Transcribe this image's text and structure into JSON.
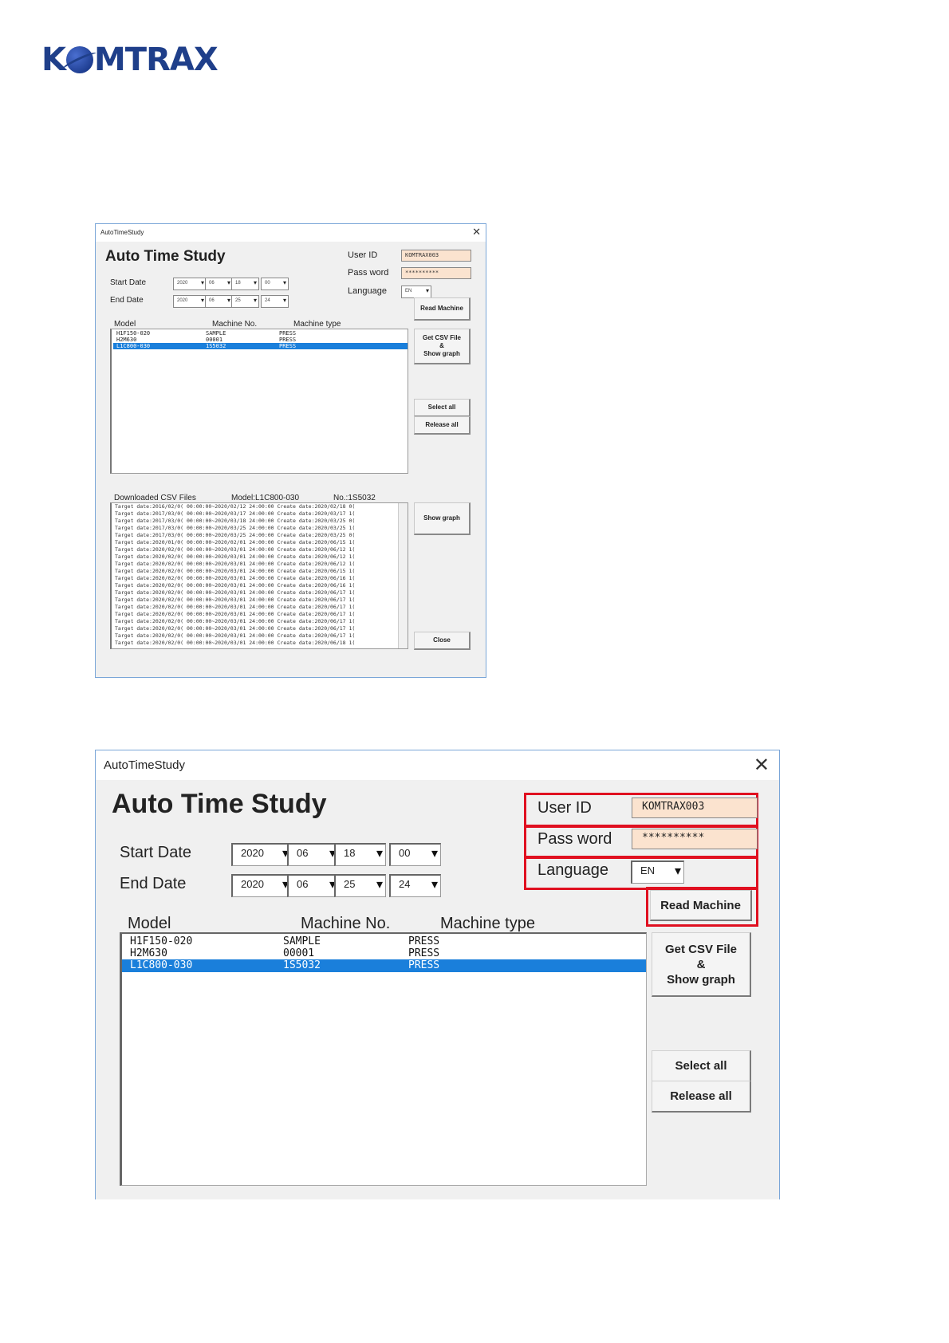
{
  "logo": {
    "pre": "K",
    "post": "MTRAX"
  },
  "app": {
    "window_title": "AutoTimeStudy",
    "heading": "Auto Time Study",
    "labels": {
      "user_id": "User ID",
      "password": "Pass word",
      "language": "Language",
      "start_date": "Start Date",
      "end_date": "End Date"
    },
    "user_id_value": "KOMTRAX003",
    "password_value": "**********",
    "language_value": "EN",
    "start_date": {
      "year": "2020",
      "month": "06",
      "day": "18",
      "hour": "00"
    },
    "end_date": {
      "year": "2020",
      "month": "06",
      "day": "25",
      "hour": "24"
    },
    "columns": {
      "model": "Model",
      "machine_no": "Machine No.",
      "machine_type": "Machine type"
    },
    "machines": [
      {
        "model": "H1F150-020",
        "no": "SAMPLE",
        "type": "PRESS"
      },
      {
        "model": "H2M630",
        "no": "00001",
        "type": "PRESS"
      },
      {
        "model": "L1C800-030",
        "no": "1S5032",
        "type": "PRESS"
      }
    ],
    "buttons": {
      "read_machine": "Read Machine",
      "get_csv_1": "Get CSV File",
      "get_csv_2": "&",
      "get_csv_3": "Show graph",
      "select_all": "Select all",
      "release_all": "Release all",
      "show_graph": "Show graph",
      "close": "Close"
    },
    "csv": {
      "label": "Downloaded CSV Files",
      "model": "Model:L1C800-030",
      "no": "No.:1S5032",
      "lines": [
        "Target date:2016/02/0( 00:00:00~2020/02/12 24:00:00 Create date:2020/02/18 0(",
        "Target date:2017/03/0( 00:00:00~2020/03/17 24:00:00 Create date:2020/03/17 1(",
        "Target date:2017/03/0( 00:00:00~2020/03/18 24:00:00 Create date:2020/03/25 0(",
        "Target date:2017/03/0( 00:00:00~2020/03/25 24:00:00 Create date:2020/03/25 1(",
        "Target date:2017/03/0( 00:00:00~2020/03/25 24:00:00 Create date:2020/03/25 0(",
        "Target date:2020/01/0( 00:00:00~2020/02/01 24:00:00 Create date:2020/06/15 1(",
        "Target date:2020/02/0( 00:00:00~2020/03/01 24:00:00 Create date:2020/06/12 1(",
        "Target date:2020/02/0( 00:00:00~2020/03/01 24:00:00 Create date:2020/06/12 1(",
        "Target date:2020/02/0( 00:00:00~2020/03/01 24:00:00 Create date:2020/06/12 1(",
        "Target date:2020/02/0( 00:00:00~2020/03/01 24:00:00 Create date:2020/06/15 1(",
        "Target date:2020/02/0( 00:00:00~2020/03/01 24:00:00 Create date:2020/06/16 1(",
        "Target date:2020/02/0( 00:00:00~2020/03/01 24:00:00 Create date:2020/06/16 1(",
        "Target date:2020/02/0( 00:00:00~2020/03/01 24:00:00 Create date:2020/06/17 1(",
        "Target date:2020/02/0( 00:00:00~2020/03/01 24:00:00 Create date:2020/06/17 1(",
        "Target date:2020/02/0( 00:00:00~2020/03/01 24:00:00 Create date:2020/06/17 1(",
        "Target date:2020/02/0( 00:00:00~2020/03/01 24:00:00 Create date:2020/06/17 1(",
        "Target date:2020/02/0( 00:00:00~2020/03/01 24:00:00 Create date:2020/06/17 1(",
        "Target date:2020/02/0( 00:00:00~2020/03/01 24:00:00 Create date:2020/06/17 1(",
        "Target date:2020/02/0( 00:00:00~2020/03/01 24:00:00 Create date:2020/06/17 1(",
        "Target date:2020/02/0( 00:00:00~2020/03/01 24:00:00 Create date:2020/06/18 1("
      ]
    }
  }
}
